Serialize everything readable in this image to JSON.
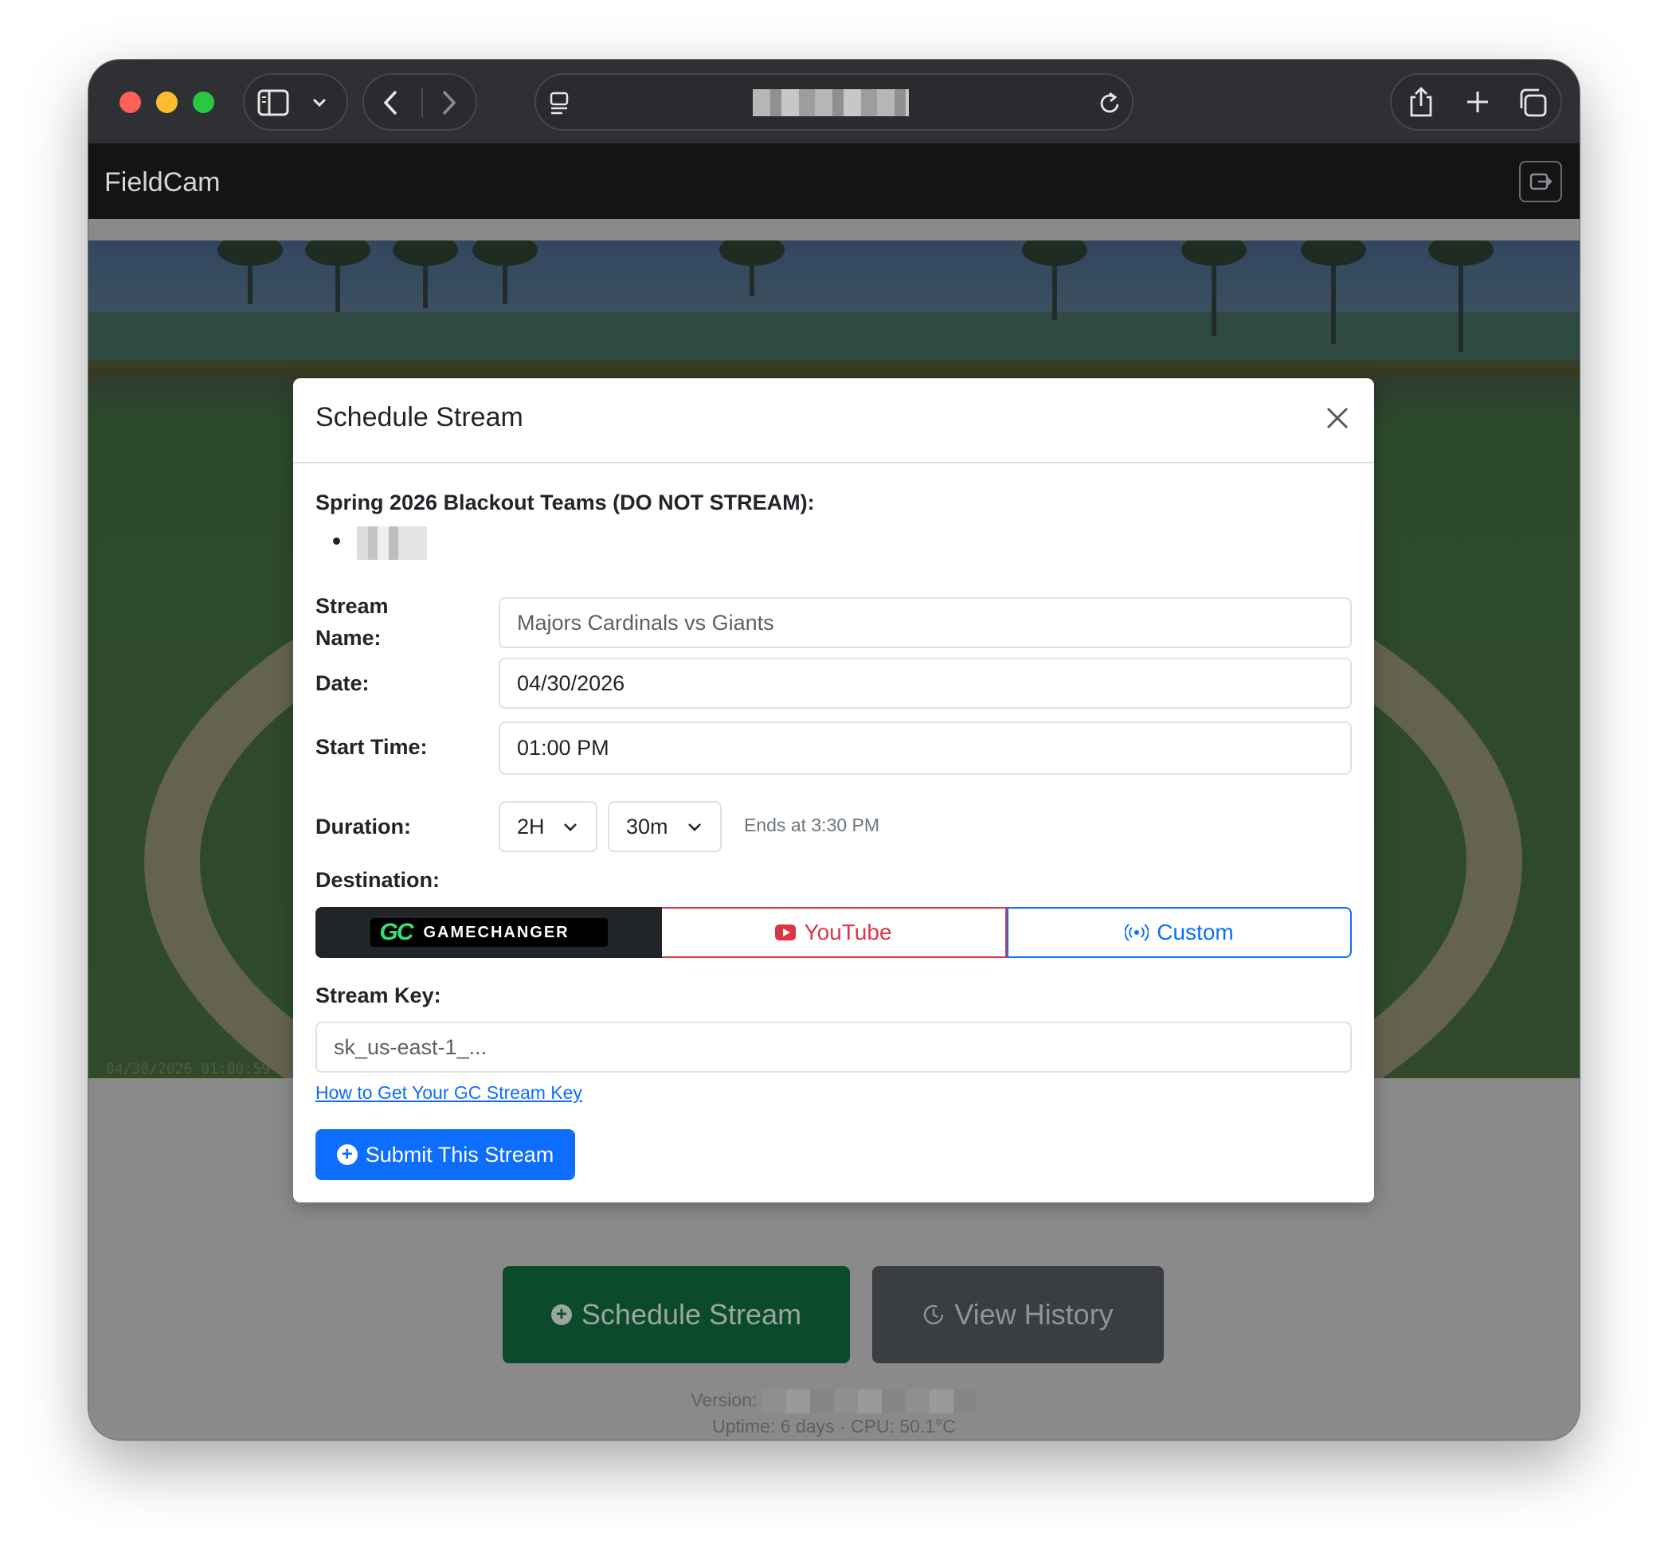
{
  "browser": {
    "tab_icons": [
      "sidebar-icon",
      "chevron-down-icon",
      "back-icon",
      "forward-icon",
      "reader-icon",
      "reload-icon",
      "share-icon",
      "new-tab-icon",
      "tabs-overview-icon"
    ]
  },
  "app": {
    "brand": "FieldCam",
    "camera_timestamp": "04/30/2026 01:00:59"
  },
  "page": {
    "schedule_button": "Schedule Stream",
    "history_button": "View History",
    "version_label": "Version:",
    "uptime": "Uptime: 6 days · CPU: 50.1°C"
  },
  "modal": {
    "title": "Schedule Stream",
    "blackout_heading": "Spring 2026 Blackout Teams (DO NOT STREAM):",
    "stream_name_label_1": "Stream",
    "stream_name_label_2": "Name:",
    "stream_name_placeholder": "Majors Cardinals vs Giants",
    "date_label": "Date:",
    "date_value": "04/30/2026",
    "start_time_label": "Start Time:",
    "start_time_value": "01:00 PM",
    "duration_label": "Duration:",
    "duration_hours": "2H",
    "duration_minutes": "30m",
    "ends_at": "Ends at 3:30 PM",
    "destination_label": "Destination:",
    "destinations": {
      "gamechanger_mark": "GC",
      "gamechanger_word": "GAMECHANGER",
      "youtube": "YouTube",
      "custom": "Custom"
    },
    "stream_key_label": "Stream Key:",
    "stream_key_placeholder": "sk_us-east-1_...",
    "help_link": "How to Get Your GC Stream Key",
    "submit_label": "Submit This Stream"
  },
  "colors": {
    "primary": "#0d6efd",
    "danger": "#dc3545",
    "dark": "#212529",
    "success_dim": "#0b4a2a"
  }
}
